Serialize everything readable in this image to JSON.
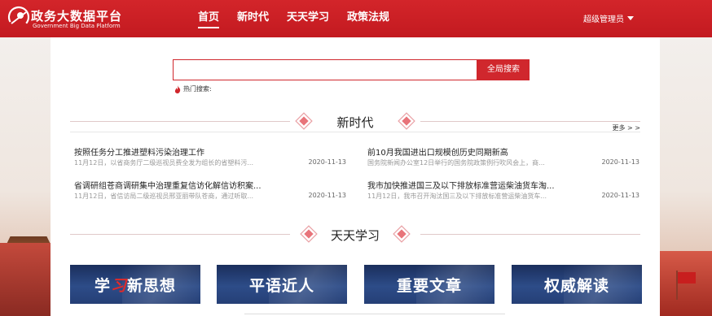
{
  "header": {
    "logo_title": "政务大数据平台",
    "logo_subtitle": "Government Big Data Platform",
    "nav": [
      {
        "label": "首页",
        "active": true
      },
      {
        "label": "新时代",
        "active": false
      },
      {
        "label": "天天学习",
        "active": false
      },
      {
        "label": "政策法规",
        "active": false
      }
    ],
    "user": "超级管理员",
    "accent_color": "#d0272d"
  },
  "search": {
    "value": "",
    "placeholder": "",
    "button_label": "全局搜索",
    "hot_label": "热门搜索:"
  },
  "new_era": {
    "title": "新时代",
    "more": "更多 > >",
    "items": [
      {
        "headline": "按照任务分工推进塑料污染治理工作",
        "summary": "11月12日，以省商务厅二级巡视员费全发为组长的省塑料污...",
        "date": "2020-11-13"
      },
      {
        "headline": "前10月我国进出口规模创历史同期新高",
        "summary": "国务院新闻办公室12日举行的国务院政策例行吹风会上，商...",
        "date": "2020-11-13"
      },
      {
        "headline": "省调研组苍商调研集中治理重复信访化解信访积案...",
        "summary": "11月12日，省信访局二级巡视员邢亚丽带队苍商，通过听取...",
        "date": "2020-11-13"
      },
      {
        "headline": "我市加快推进国三及以下排放标准营运柴油货车淘...",
        "summary": "11月12日，我市召开淘汰国三及以下排放标准营运柴油货车...",
        "date": "2020-11-13"
      }
    ]
  },
  "daily_study": {
    "title": "天天学习",
    "cards": [
      {
        "prefix": "学",
        "accent": "习",
        "suffix": "新思想"
      },
      {
        "prefix": "平语近人",
        "accent": "",
        "suffix": ""
      },
      {
        "prefix": "重要文章",
        "accent": "",
        "suffix": ""
      },
      {
        "prefix": "权威解读",
        "accent": "",
        "suffix": ""
      }
    ]
  }
}
